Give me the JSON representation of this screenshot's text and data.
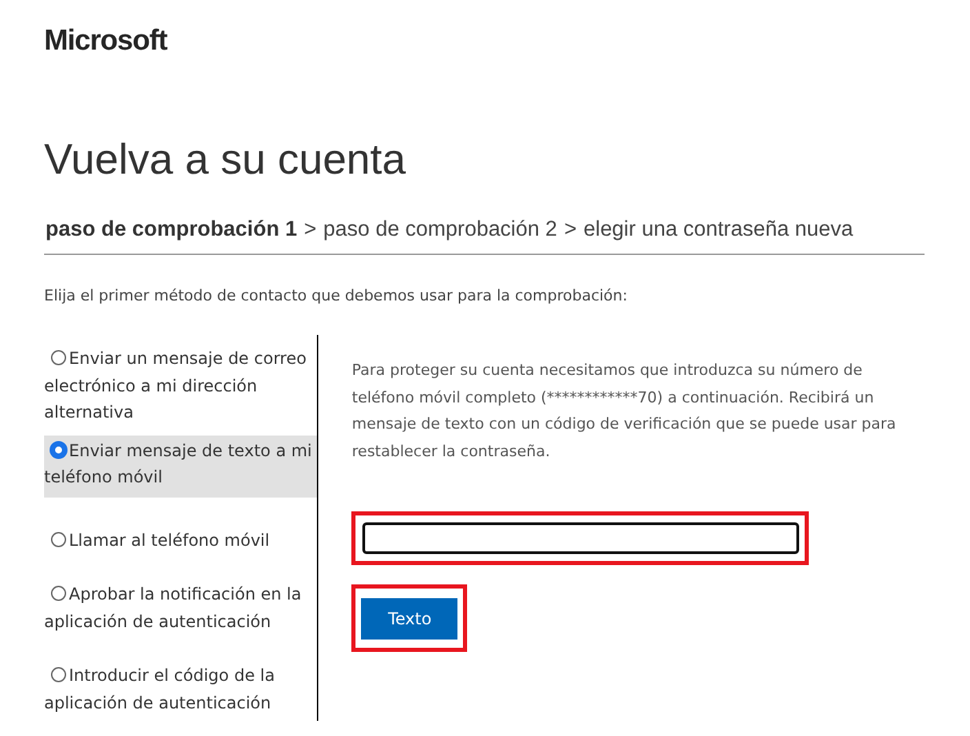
{
  "logo": "Microsoft",
  "title": "Vuelva a su cuenta",
  "steps": [
    {
      "label": "paso de comprobación 1",
      "selected": true
    },
    {
      "label": "paso de comprobación 2",
      "selected": false
    },
    {
      "label": "elegir una contraseña nueva",
      "selected": false
    }
  ],
  "step_separators": [
    ">",
    ">"
  ],
  "instruction": "Elija el primer método de contacto que debemos usar para la comprobación:",
  "methods": [
    {
      "label": "Enviar un mensaje de correo electrónico a mi dirección alternativa",
      "selected": false
    },
    {
      "label": "Enviar mensaje de texto a mi teléfono móvil",
      "selected": true
    },
    {
      "label": "Llamar al teléfono móvil",
      "selected": false
    },
    {
      "label": "Aprobar la notificación en la aplicación de autenticación",
      "selected": false
    },
    {
      "label": "Introducir el código de la aplicación de autenticación",
      "selected": false
    }
  ],
  "details": {
    "message": "Para proteger su cuenta necesitamos que introduzca su número de teléfono móvil completo (************70) a continuación. Recibirá un mensaje de texto con un código de verificación que se puede usar para restablecer la contraseña.",
    "phone_field": {
      "highlighted": true
    },
    "submit_button": {
      "label": "Texto",
      "highlighted": true
    }
  }
}
